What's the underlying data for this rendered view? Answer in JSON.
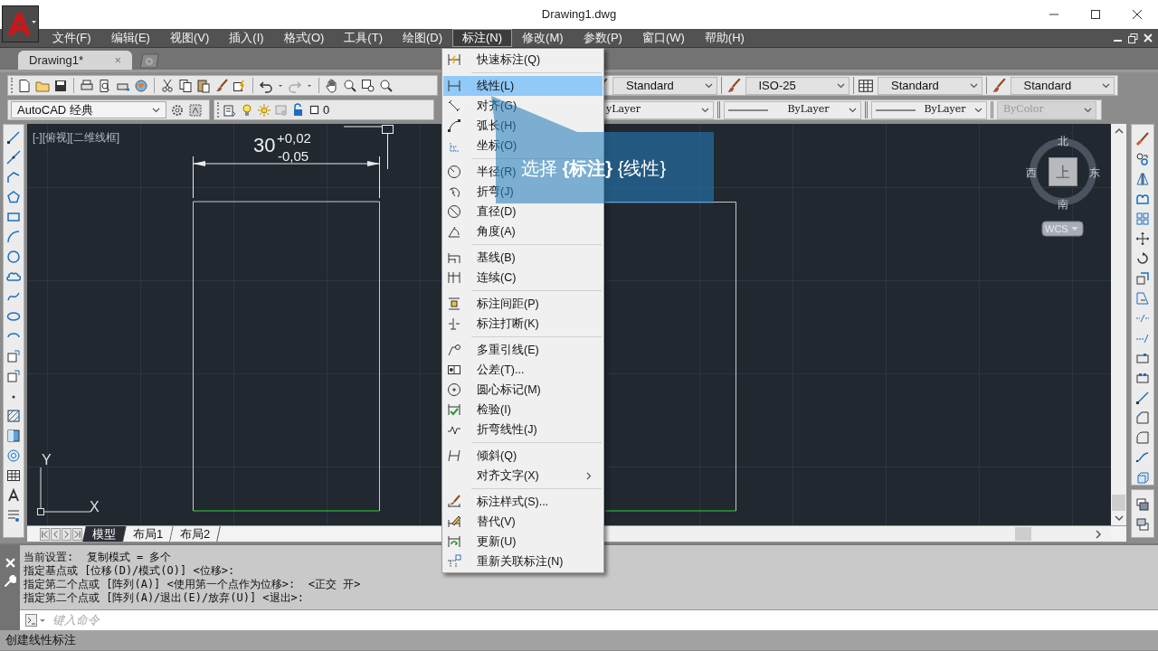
{
  "window": {
    "title": "Drawing1.dwg"
  },
  "menu_bar": [
    {
      "label": "文件(F)",
      "selected": false
    },
    {
      "label": "编辑(E)",
      "selected": false
    },
    {
      "label": "视图(V)",
      "selected": false
    },
    {
      "label": "插入(I)",
      "selected": false
    },
    {
      "label": "格式(O)",
      "selected": false
    },
    {
      "label": "工具(T)",
      "selected": false
    },
    {
      "label": "绘图(D)",
      "selected": false
    },
    {
      "label": "标注(N)",
      "selected": true
    },
    {
      "label": "修改(M)",
      "selected": false
    },
    {
      "label": "参数(P)",
      "selected": false
    },
    {
      "label": "窗口(W)",
      "selected": false
    },
    {
      "label": "帮助(H)",
      "selected": false
    }
  ],
  "document_tab": {
    "label": "Drawing1*",
    "close": "×"
  },
  "style_dropdowns": [
    {
      "value": "Standard"
    },
    {
      "value": "ISO-25"
    },
    {
      "value": "Standard"
    },
    {
      "value": "Standard"
    }
  ],
  "workspace": {
    "value": "AutoCAD 经典"
  },
  "layer": {
    "value": "0"
  },
  "property_dropdowns": [
    {
      "value": "yLayer",
      "line": false,
      "disabled": false
    },
    {
      "value": "ByLayer",
      "line": true,
      "disabled": false
    },
    {
      "value": "ByLayer",
      "line": true,
      "disabled": false
    },
    {
      "value": "ByColor",
      "line": false,
      "disabled": true
    }
  ],
  "viewport_label": "[-][俯视][二维线框]",
  "dimension": {
    "value": "30",
    "upper_tolerance": "+0,02",
    "lower_tolerance": "-0,05"
  },
  "view_cube": {
    "north": "北",
    "south": "南",
    "east": "东",
    "west": "西",
    "face": "上",
    "ucs": "WCS"
  },
  "ucs_axes": {
    "x": "X",
    "y": "Y"
  },
  "layout_tabs": [
    {
      "label": "模型",
      "selected": true
    },
    {
      "label": "布局1",
      "selected": false
    },
    {
      "label": "布局2",
      "selected": false
    }
  ],
  "dropdown_menu": {
    "sections": [
      [
        {
          "label": "快速标注(Q)",
          "selected": false,
          "submenu": false
        }
      ],
      [
        {
          "label": "线性(L)",
          "selected": true,
          "submenu": false
        },
        {
          "label": "对齐(G)",
          "selected": false,
          "submenu": false
        },
        {
          "label": "弧长(H)",
          "selected": false,
          "submenu": false
        },
        {
          "label": "坐标(O)",
          "selected": false,
          "submenu": false
        }
      ],
      [
        {
          "label": "半径(R)",
          "selected": false,
          "submenu": false
        },
        {
          "label": "折弯(J)",
          "selected": false,
          "submenu": false
        },
        {
          "label": "直径(D)",
          "selected": false,
          "submenu": false
        },
        {
          "label": "角度(A)",
          "selected": false,
          "submenu": false
        }
      ],
      [
        {
          "label": "基线(B)",
          "selected": false,
          "submenu": false
        },
        {
          "label": "连续(C)",
          "selected": false,
          "submenu": false
        }
      ],
      [
        {
          "label": "标注间距(P)",
          "selected": false,
          "submenu": false
        },
        {
          "label": "标注打断(K)",
          "selected": false,
          "submenu": false
        }
      ],
      [
        {
          "label": "多重引线(E)",
          "selected": false,
          "submenu": false
        },
        {
          "label": "公差(T)...",
          "selected": false,
          "submenu": false
        },
        {
          "label": "圆心标记(M)",
          "selected": false,
          "submenu": false
        },
        {
          "label": "检验(I)",
          "selected": false,
          "submenu": false
        },
        {
          "label": "折弯线性(J)",
          "selected": false,
          "submenu": false
        }
      ],
      [
        {
          "label": "倾斜(Q)",
          "selected": false,
          "submenu": false
        },
        {
          "label": "对齐文字(X)",
          "selected": false,
          "submenu": true
        }
      ],
      [
        {
          "label": "标注样式(S)...",
          "selected": false,
          "submenu": false
        },
        {
          "label": "替代(V)",
          "selected": false,
          "submenu": false
        },
        {
          "label": "更新(U)",
          "selected": false,
          "submenu": false
        },
        {
          "label": "重新关联标注(N)",
          "selected": false,
          "submenu": false
        }
      ]
    ]
  },
  "callout": {
    "text": "选择 **{标注}** {线性}"
  },
  "command_history": [
    "当前设置:  复制模式 = 多个",
    "指定基点或 [位移(D)/模式(O)] <位移>:",
    "指定第二个点或 [阵列(A)] <使用第一个点作为位移>:  <正交 开>",
    "指定第二个点或 [阵列(A)/退出(E)/放弃(U)] <退出>:"
  ],
  "command_input": {
    "placeholder": "键入命令"
  },
  "status_bar": {
    "text": "创建线性标注"
  }
}
